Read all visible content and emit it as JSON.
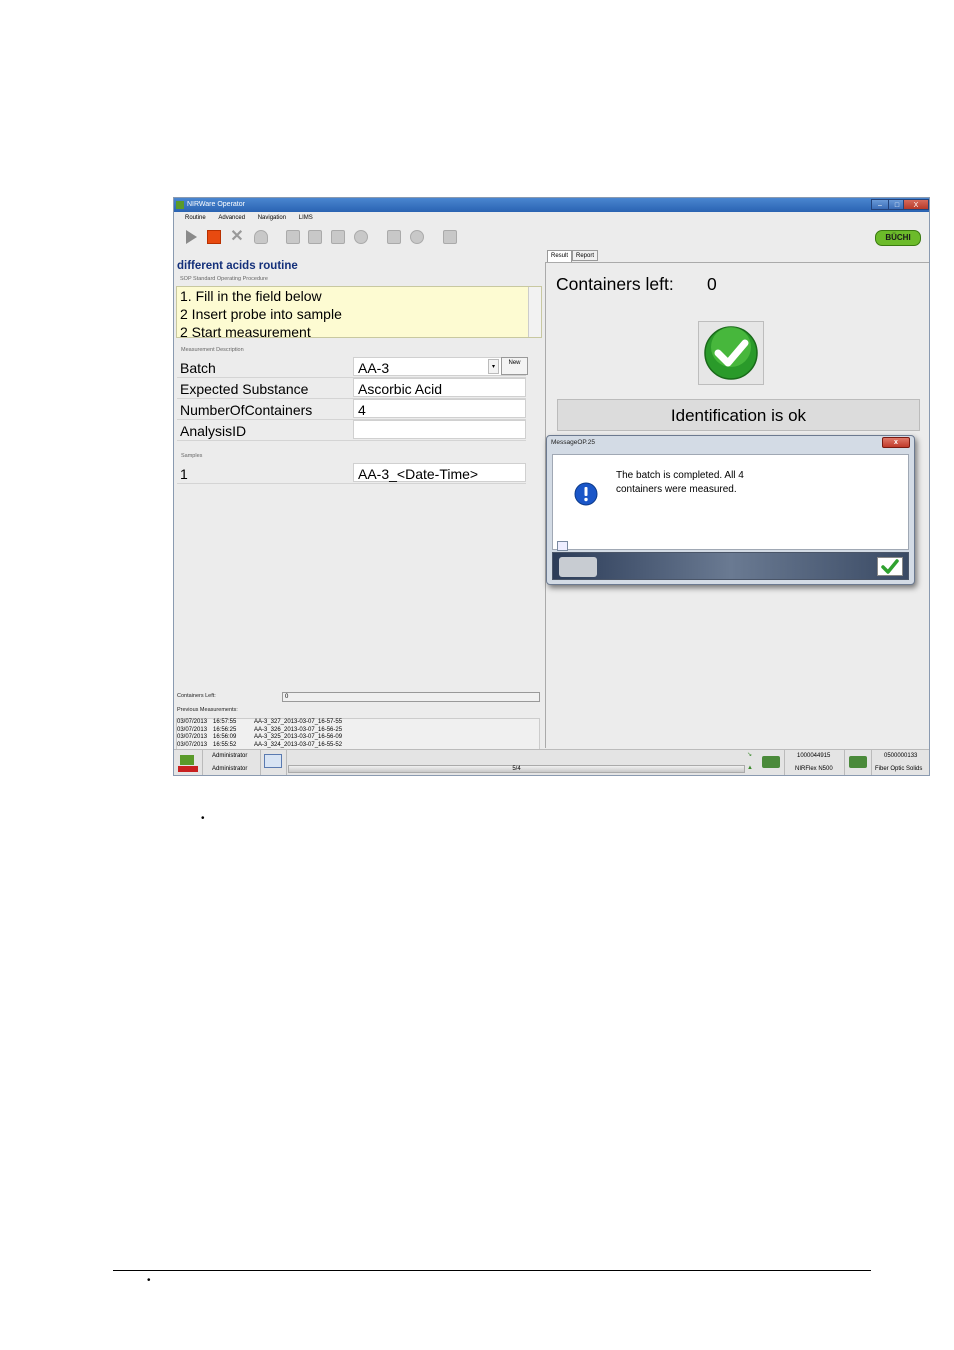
{
  "app": {
    "title": "NIRWare Operator",
    "window_buttons": [
      "–",
      "□",
      "X"
    ],
    "menu": [
      "Routine",
      "Advanced",
      "Navigation",
      "LIMS"
    ],
    "logo": "BÜCHI",
    "colors": {
      "accent": "#2a63b2",
      "sop_bg": "#fdfbd2",
      "stop": "#e84a10",
      "ok_green": "#2fa12f",
      "info_blue": "#1a56c8"
    }
  },
  "left": {
    "routine_title": "different acids routine",
    "sop_label": "SOP Standard Operating Procedure",
    "sop_lines": [
      "1. Fill in the field below",
      "2  Insert probe into sample",
      "2  Start measurement"
    ],
    "measurement_label": "Measurement Description",
    "fields": [
      {
        "key": "Batch",
        "value": "AA-3"
      },
      {
        "key": "Expected Substance",
        "value": "Ascorbic Acid"
      },
      {
        "key": "NumberOfContainers",
        "value": "4"
      },
      {
        "key": "AnalysisID",
        "value": ""
      }
    ],
    "new_button": "New",
    "samples_label": "Samples",
    "samples": [
      {
        "key": "1",
        "value": "AA-3_<Date-Time>"
      }
    ],
    "containers_left_label": "Containers Left:",
    "containers_left_value": "0",
    "previous_label": "Previous Measurements:",
    "previous": [
      {
        "date": "03/07/2013",
        "time": "16:57:55",
        "name": "AA-3_327_2013-03-07_16-57-55"
      },
      {
        "date": "03/07/2013",
        "time": "16:56:25",
        "name": "AA-3_326_2013-03-07_16-56-25"
      },
      {
        "date": "03/07/2013",
        "time": "16:56:09",
        "name": "AA-3_325_2013-03-07_16-56-09"
      },
      {
        "date": "03/07/2013",
        "time": "16:55:52",
        "name": "AA-3_324_2013-03-07_16-55-52"
      }
    ]
  },
  "right": {
    "tabs": [
      "Result",
      "Report"
    ],
    "containers_left_label": "Containers left:",
    "containers_left_value": "0",
    "identification": "Identification is ok"
  },
  "dialog": {
    "title": "MessageOP.25",
    "close": "x",
    "message": "The batch is completed. All 4 containers were measured."
  },
  "status": {
    "user1": "Administrator",
    "user2": "Administrator",
    "progress_text": "5/4",
    "serial1": "1000044915",
    "device": "NIRFlex N500",
    "serial2": "0500000133",
    "module": "Fiber Optic Solids"
  }
}
